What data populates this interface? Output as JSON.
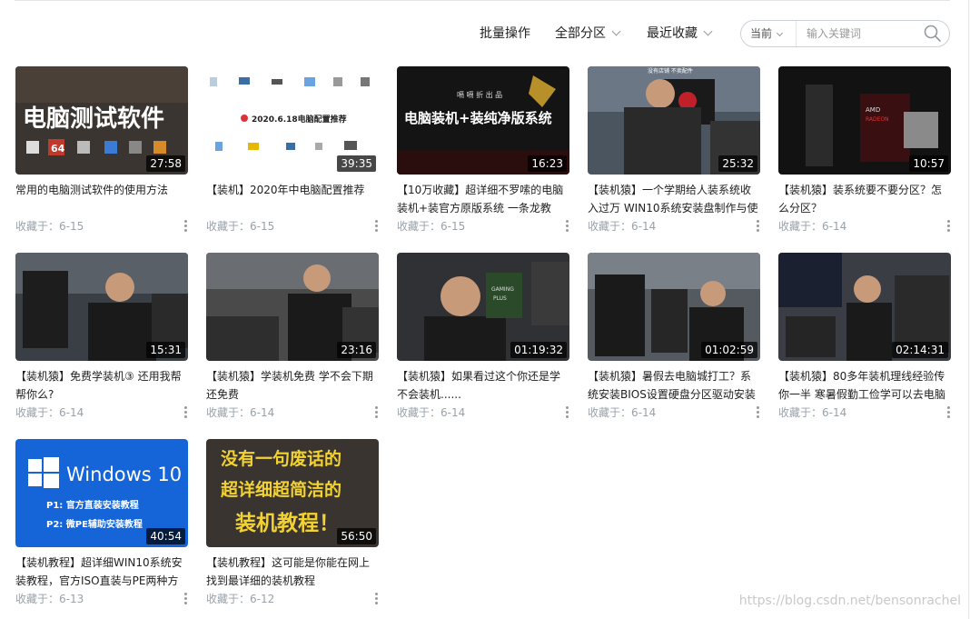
{
  "toolbar": {
    "batch_label": "批量操作",
    "partition_label": "全部分区",
    "sort_label": "最近收藏",
    "search_scope": "当前",
    "search_placeholder": "输入关键词"
  },
  "meta_prefix": "收藏于：",
  "watermark": "https://blog.csdn.net/bensonrachel",
  "colors": {
    "text": "#212121",
    "meta": "#99a2aa",
    "border": "#ccd0d7"
  },
  "items": [
    {
      "title": "常用的电脑测试软件的使用方法",
      "duration": "27:58",
      "date": "6-15",
      "thumb_text": [
        "电脑测试软件"
      ],
      "thumb_small": [
        "64"
      ]
    },
    {
      "title": "【装机】2020年中电脑配置推荐",
      "duration": "39:35",
      "date": "6-15",
      "thumb_text": [
        "2020.6.18电脑配置推荐"
      ]
    },
    {
      "title": "【10万收藏】超详细不罗嗦的电脑装机+装官方原版系统 一条龙教",
      "duration": "16:23",
      "date": "6-15",
      "thumb_text": [
        "电脑装机+装纯净版系统"
      ],
      "thumb_small": [
        "嗝 嗝 折 出 品"
      ]
    },
    {
      "title": "【装机猿】一个学期给人装系统收入过万 WIN10系统安装盘制作与使",
      "duration": "25:32",
      "date": "6-14",
      "thumb_small": [
        "没有店铺 不卖配件"
      ]
    },
    {
      "title": "【装机猿】装系统要不要分区？怎么分区？",
      "duration": "10:57",
      "date": "6-14",
      "thumb_small": [
        "AMD",
        "RADEON"
      ]
    },
    {
      "title": "【装机猿】免费学装机③ 还用我帮帮你么?",
      "duration": "15:31",
      "date": "6-14"
    },
    {
      "title": "【装机猿】学装机免费 学不会下期还免费",
      "duration": "23:16",
      "date": "6-14"
    },
    {
      "title": "【装机猿】如果看过这个你还是学不会装机......",
      "duration": "01:19:32",
      "date": "6-14",
      "thumb_small": [
        "GAMING",
        "PLUS"
      ]
    },
    {
      "title": "【装机猿】暑假去电脑城打工？系统安装BIOS设置硬盘分区驱动安装",
      "duration": "01:02:59",
      "date": "6-14"
    },
    {
      "title": "【装机猿】80多年装机理线经验传你一半 寒暑假勤工俭学可以去电脑",
      "duration": "02:14:31",
      "date": "6-14"
    },
    {
      "title": "【装机教程】超详细WIN10系统安装教程，官方ISO直装与PE两种方",
      "duration": "40:54",
      "date": "6-13",
      "thumb_text": [
        "Windows 10",
        "P1:  官方直装安装教程",
        "P2:  微PE辅助安装教程"
      ]
    },
    {
      "title": "【装机教程】这可能是你能在网上找到最详细的装机教程",
      "duration": "56:50",
      "date": "6-12",
      "thumb_text": [
        "没有一句废话的",
        "超详细超简洁的",
        "装机教程！"
      ]
    }
  ]
}
